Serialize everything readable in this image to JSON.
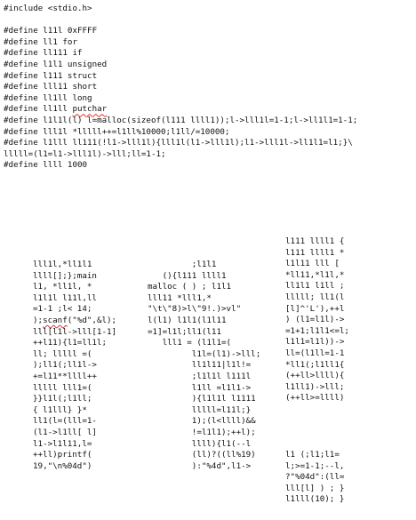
{
  "defines": [
    "#include <stdio.h>",
    "",
    "#define l11l 0xFFFF",
    "#define ll1 for",
    "#define ll111 if",
    "#define l1l1 unsigned",
    "#define l111 struct",
    "#define lll11 short",
    "#define ll1ll long",
    "#define ll1ll putchar",
    "#define l1l1l(l) l=malloc(sizeof(l111 llll1));l->lll1l=1-1;l->ll1l1=1-1;",
    "#define lll1l *lllll++=l1ll%10000;l1ll/=10000;",
    "#define l1lll ll111(!l1->lll1l){lll1l(l1->lll1l);l1->lll1l->ll1l1=l1;}\\",
    "lllll=(l1=l1->lll1l)->lll;ll=1-1;",
    "#define llll 1000"
  ],
  "art": {
    "col_a": [
      "lll1l,*ll1l1",
      "llll[];};main",
      "l1, *ll1l, *",
      "l1l1l l11l,ll",
      "=1-1 ;l< 14;",
      ");scanf(\"%d\",&l);",
      "lll[l1l->lll[1-1]",
      "++l11){l1=ll1l;",
      "ll; lllll =(",
      ");ll1(;ll1l->",
      "+=l11**llll++",
      "lllll lll1=(",
      "}}l1l(;l1ll;",
      "{ l1lll} }*",
      "ll1(l=(lll=1-",
      "(l1->l1ll[ l]",
      "l1->l1l11,l=",
      "++ll)printf(",
      "19,\"\\n%04d\")"
    ],
    "col_b": [
      "",
      "",
      "",
      "",
      "",
      "",
      "",
      "",
      "",
      "",
      "",
      "",
      "",
      "",
      "",
      "",
      "",
      "",
      ""
    ],
    "col_c": [
      "         ;l1l1",
      "   (){l111 llll1",
      "malloc ( ) ; l1l1",
      "lll11 *lll1,*",
      "\"\\t\\\"8)>l\\\"9!.)>vl\"",
      "l(l1) l1l1(l1l11",
      "=1]=l1l;ll1(l11",
      "   lll1 = (l1l1=(",
      "         l1l=(l1)->lll;",
      "         ll1l11|l1l!=",
      "         ;l1l1l l111l",
      "         l1ll =l1l1->",
      "         ){l1l1l l1111",
      "         lllll=l11l;}",
      "         1);(l<llll)&&",
      "         !=l1l1);++l);",
      "         llll){l1(--l",
      "         (ll)?((ll%19)",
      "         ):\"%4d\",l1->"
    ],
    "col_d": [
      "l111 llll1 {",
      "l111 llll1 *",
      "l1l11 lll [",
      "*ll11,*l1l,*",
      "ll1l1 l1ll ;",
      "lllll; ll1(l",
      "[l]^'L'),++l",
      ") (l1=l1l)->",
      "=1+1;l1l1<=l;",
      "l1l1=l1l))->",
      "ll=(l1ll=1-1",
      "*ll1(;l1ll1{",
      "(++ll>llll){",
      "l1ll1)->lll;",
      "(++ll>=llll)"
    ],
    "col_e": [
      "l1 (;l1;l1=",
      "l;>=1-1;--l,",
      "?\"%04d\":(ll=",
      "lll[l] ) ; }",
      "l1lll(10); }"
    ],
    "scanf_word": "scanf",
    "putchar_word": "putchar"
  }
}
